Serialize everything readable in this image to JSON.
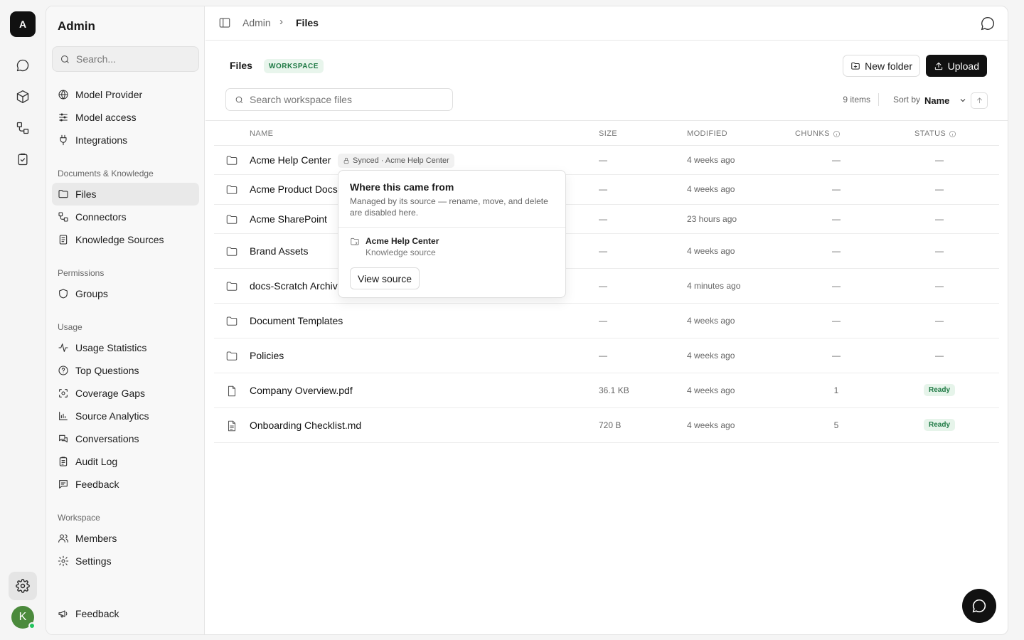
{
  "rail": {
    "workspace_initial": "A",
    "avatar_initial": "K"
  },
  "sidebar": {
    "title": "Admin",
    "search_placeholder": "Search...",
    "top_items": [
      {
        "label": "Model Provider",
        "icon": "globe-icon"
      },
      {
        "label": "Model access",
        "icon": "sliders-icon"
      },
      {
        "label": "Integrations",
        "icon": "plug-icon"
      }
    ],
    "sections": [
      {
        "title": "Documents & Knowledge",
        "items": [
          {
            "label": "Files",
            "icon": "folder-icon",
            "active": true
          },
          {
            "label": "Connectors",
            "icon": "connector-icon"
          },
          {
            "label": "Knowledge Sources",
            "icon": "book-icon"
          }
        ]
      },
      {
        "title": "Permissions",
        "items": [
          {
            "label": "Groups",
            "icon": "shield-icon"
          }
        ]
      },
      {
        "title": "Usage",
        "items": [
          {
            "label": "Usage Statistics",
            "icon": "activity-icon"
          },
          {
            "label": "Top Questions",
            "icon": "help-circle-icon"
          },
          {
            "label": "Coverage Gaps",
            "icon": "scan-icon"
          },
          {
            "label": "Source Analytics",
            "icon": "bar-chart-icon"
          },
          {
            "label": "Conversations",
            "icon": "messages-icon"
          },
          {
            "label": "Audit Log",
            "icon": "clipboard-icon"
          },
          {
            "label": "Feedback",
            "icon": "feedback-icon"
          }
        ]
      },
      {
        "title": "Workspace",
        "items": [
          {
            "label": "Members",
            "icon": "users-icon"
          },
          {
            "label": "Settings",
            "icon": "gear-icon"
          }
        ]
      }
    ],
    "footer_feedback": "Feedback"
  },
  "topbar": {
    "breadcrumb_root": "Admin",
    "breadcrumb_sep": "›",
    "breadcrumb_current": "Files"
  },
  "page": {
    "title": "Files",
    "badge": "WORKSPACE",
    "new_folder": "New folder",
    "upload": "Upload",
    "search_placeholder": "Search workspace files",
    "items_count": "9 items",
    "sort_label": "Sort by",
    "sort_value": "Name"
  },
  "table": {
    "columns": {
      "name": "NAME",
      "size": "SIZE",
      "modified": "MODIFIED",
      "chunks": "CHUNKS",
      "status": "STATUS"
    },
    "rows": [
      {
        "name": "Acme Help Center",
        "type": "folder",
        "size": "—",
        "modified": "4 weeks ago",
        "chunks": "—",
        "status": "—",
        "synced": "Synced · Acme Help Center"
      },
      {
        "name": "Acme Product Docs",
        "type": "folder",
        "size": "—",
        "modified": "4 weeks ago",
        "chunks": "—",
        "status": "—"
      },
      {
        "name": "Acme SharePoint",
        "type": "folder",
        "size": "—",
        "modified": "23 hours ago",
        "chunks": "—",
        "status": "—"
      },
      {
        "name": "Brand Assets",
        "type": "folder",
        "size": "—",
        "modified": "4 weeks ago",
        "chunks": "—",
        "status": "—"
      },
      {
        "name": "docs-Scratch Archive",
        "type": "folder",
        "size": "—",
        "modified": "4 minutes ago",
        "chunks": "—",
        "status": "—"
      },
      {
        "name": "Document Templates",
        "type": "folder",
        "size": "—",
        "modified": "4 weeks ago",
        "chunks": "—",
        "status": "—"
      },
      {
        "name": "Policies",
        "type": "folder",
        "size": "—",
        "modified": "4 weeks ago",
        "chunks": "—",
        "status": "—"
      },
      {
        "name": "Company Overview.pdf",
        "type": "file",
        "size": "36.1 KB",
        "modified": "4 weeks ago",
        "chunks": "1",
        "status": "Ready"
      },
      {
        "name": "Onboarding Checklist.md",
        "type": "doc",
        "size": "720 B",
        "modified": "4 weeks ago",
        "chunks": "5",
        "status": "Ready"
      }
    ]
  },
  "popover": {
    "title": "Where this came from",
    "description": "Managed by its source — rename, move, and delete are disabled here.",
    "source_name": "Acme Help Center",
    "source_type": "Knowledge source",
    "button": "View source"
  }
}
